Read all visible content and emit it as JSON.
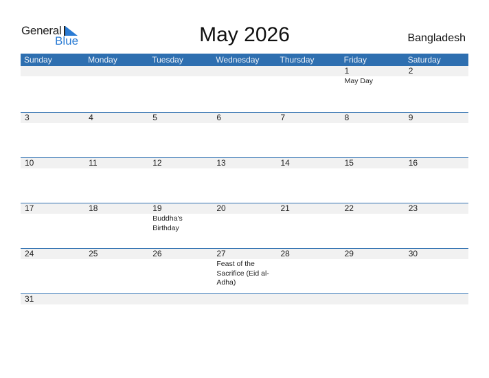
{
  "logo": {
    "word1": "General",
    "word2": "Blue"
  },
  "title": "May 2026",
  "country": "Bangladesh",
  "days_of_week": [
    "Sunday",
    "Monday",
    "Tuesday",
    "Wednesday",
    "Thursday",
    "Friday",
    "Saturday"
  ],
  "weeks": [
    [
      {
        "d": "",
        "e": ""
      },
      {
        "d": "",
        "e": ""
      },
      {
        "d": "",
        "e": ""
      },
      {
        "d": "",
        "e": ""
      },
      {
        "d": "",
        "e": ""
      },
      {
        "d": "1",
        "e": "May Day"
      },
      {
        "d": "2",
        "e": ""
      }
    ],
    [
      {
        "d": "3",
        "e": ""
      },
      {
        "d": "4",
        "e": ""
      },
      {
        "d": "5",
        "e": ""
      },
      {
        "d": "6",
        "e": ""
      },
      {
        "d": "7",
        "e": ""
      },
      {
        "d": "8",
        "e": ""
      },
      {
        "d": "9",
        "e": ""
      }
    ],
    [
      {
        "d": "10",
        "e": ""
      },
      {
        "d": "11",
        "e": ""
      },
      {
        "d": "12",
        "e": ""
      },
      {
        "d": "13",
        "e": ""
      },
      {
        "d": "14",
        "e": ""
      },
      {
        "d": "15",
        "e": ""
      },
      {
        "d": "16",
        "e": ""
      }
    ],
    [
      {
        "d": "17",
        "e": ""
      },
      {
        "d": "18",
        "e": ""
      },
      {
        "d": "19",
        "e": "Buddha's Birthday"
      },
      {
        "d": "20",
        "e": ""
      },
      {
        "d": "21",
        "e": ""
      },
      {
        "d": "22",
        "e": ""
      },
      {
        "d": "23",
        "e": ""
      }
    ],
    [
      {
        "d": "24",
        "e": ""
      },
      {
        "d": "25",
        "e": ""
      },
      {
        "d": "26",
        "e": ""
      },
      {
        "d": "27",
        "e": "Feast of the Sacrifice (Eid al-Adha)"
      },
      {
        "d": "28",
        "e": ""
      },
      {
        "d": "29",
        "e": ""
      },
      {
        "d": "30",
        "e": ""
      }
    ],
    [
      {
        "d": "31",
        "e": ""
      },
      {
        "d": "",
        "e": ""
      },
      {
        "d": "",
        "e": ""
      },
      {
        "d": "",
        "e": ""
      },
      {
        "d": "",
        "e": ""
      },
      {
        "d": "",
        "e": ""
      },
      {
        "d": "",
        "e": ""
      }
    ]
  ]
}
